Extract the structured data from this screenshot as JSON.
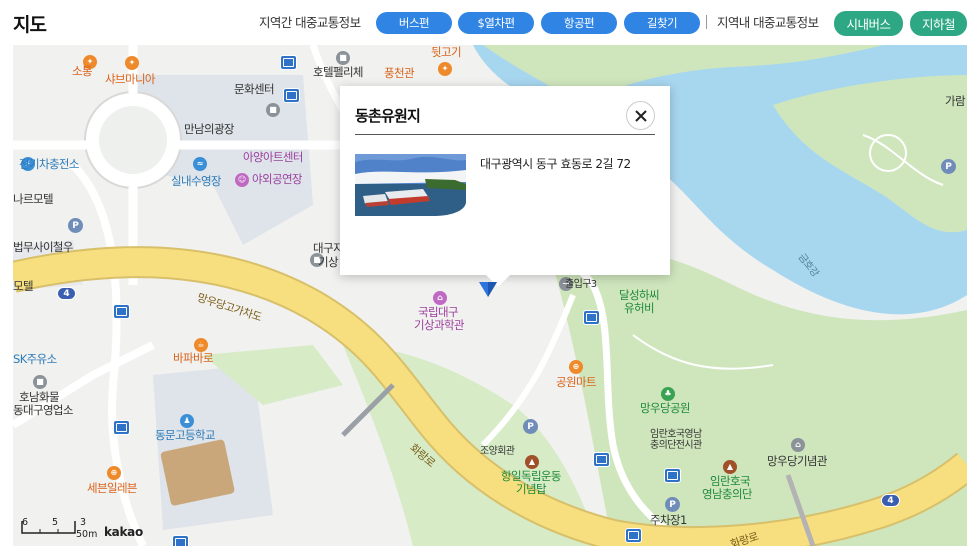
{
  "header": {
    "title": "지도",
    "intercity_label": "지역간 대중교통정보",
    "intercity_buttons": [
      "버스편",
      "$열차편",
      "항공편",
      "길찾기"
    ],
    "local_label": "지역내 대중교통정보",
    "local_buttons": [
      "시내버스",
      "지하철"
    ]
  },
  "colors": {
    "blue_button": "#2f84e4",
    "green_button": "#2ea884",
    "river": "#a7d6ef",
    "park": "#cfe6bd",
    "highway": "#f7df80"
  },
  "popup": {
    "title": "동촌유원지",
    "address": "대구광역시 동구 효동로 2길 72",
    "close_icon": "close-icon"
  },
  "map": {
    "labels": {
      "sotong": "소통",
      "shabu": "샤브마니아",
      "munhwa": "문화센터",
      "hotel": "호텔펠리체",
      "pungcheon": "풍천관",
      "twitgogi": "뒷고기",
      "mannam": "만남의광장",
      "ayang": "아양아트센터",
      "ev": "전기차충전소",
      "indoor_rink": "실내수영장",
      "outdoor_stage": "야외공연장",
      "motel1": "나르모텔",
      "law": "법무사이철우",
      "daegu_gi": "대구지",
      "gisang": "기상",
      "motel2": "모텔",
      "mangudang_overpass": "망우당고가차도",
      "bapa": "바파바로",
      "sk": "SK주유소",
      "honam1": "호남화물",
      "honam2": "동대구영업소",
      "dongmun": "동문고등학교",
      "seven": "세븐일레븐",
      "academy1": "국립대구",
      "academy2": "기상과학관",
      "exit3": "출입구3",
      "dalseong1": "달성하씨",
      "dalseong2": "유허비",
      "park_mart": "공원마트",
      "mangu_park": "망우당공원",
      "memorial1": "임란호국영남",
      "memorial2": "충의단전시관",
      "joyang": "조양회관",
      "mangu_hall": "망우당기념관",
      "indep1": "항일독립운동",
      "indep2": "기념탑",
      "yeongnam1": "임란호국",
      "yeongnam2": "영남충의단",
      "parking1": "주차장1",
      "hwarang": "화랑로",
      "geumho": "금호강",
      "garam": "가람",
      "bottom_road": "화랑로",
      "route_4a": "4",
      "route_4b": "4"
    }
  },
  "scale": {
    "label": "50m",
    "ticks": [
      "6",
      "5",
      "3"
    ]
  },
  "attribution": "kakao"
}
